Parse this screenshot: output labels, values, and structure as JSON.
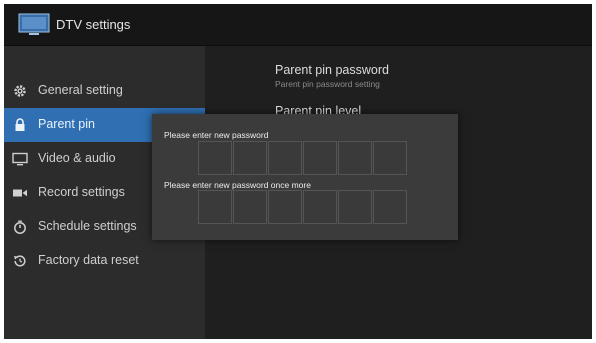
{
  "titlebar": {
    "title": "DTV settings",
    "icon": "tv-icon"
  },
  "sidebar": {
    "items": [
      {
        "label": "General setting",
        "icon": "gear-icon",
        "active": false
      },
      {
        "label": "Parent pin",
        "icon": "lock-icon",
        "active": true
      },
      {
        "label": "Video & audio",
        "icon": "monitor-icon",
        "active": false
      },
      {
        "label": "Record settings",
        "icon": "video-camera-icon",
        "active": false
      },
      {
        "label": "Schedule settings",
        "icon": "timer-icon",
        "active": false
      },
      {
        "label": "Factory data reset",
        "icon": "restore-icon",
        "active": false
      }
    ]
  },
  "content": {
    "rows": [
      {
        "title": "Parent pin password",
        "subtitle": "Parent pin password setting"
      },
      {
        "title": "Parent pin level",
        "subtitle": ""
      }
    ]
  },
  "dialog": {
    "new_password_label": "Please enter new password",
    "confirm_password_label": "Please enter new password once more",
    "digits": 6
  },
  "colors": {
    "accent": "#2f6fb2",
    "sidebar_bg": "#2c2c2d",
    "content_bg": "#1f1f1f",
    "dialog_bg": "#3b3b3c"
  }
}
